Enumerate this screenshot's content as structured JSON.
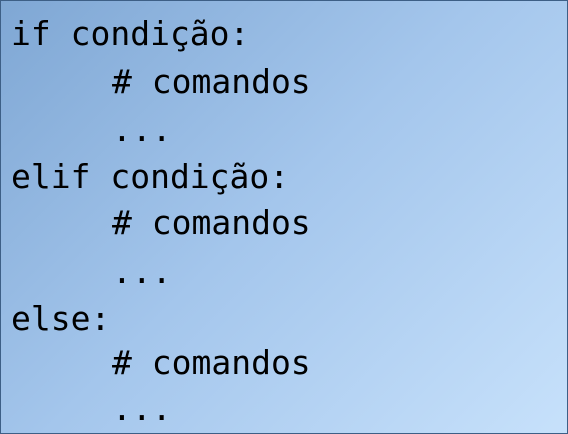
{
  "code": {
    "lines": [
      {
        "text": "if condição:",
        "indent": 0
      },
      {
        "text": "# comandos",
        "indent": 1
      },
      {
        "text": "...",
        "indent": 1
      },
      {
        "text": "elif condição:",
        "indent": 0
      },
      {
        "text": "# comandos",
        "indent": 1
      },
      {
        "text": "...",
        "indent": 1
      },
      {
        "text": "else:",
        "indent": 0
      },
      {
        "text": "# comandos",
        "indent": 1
      },
      {
        "text": "...",
        "indent": 1
      }
    ]
  }
}
